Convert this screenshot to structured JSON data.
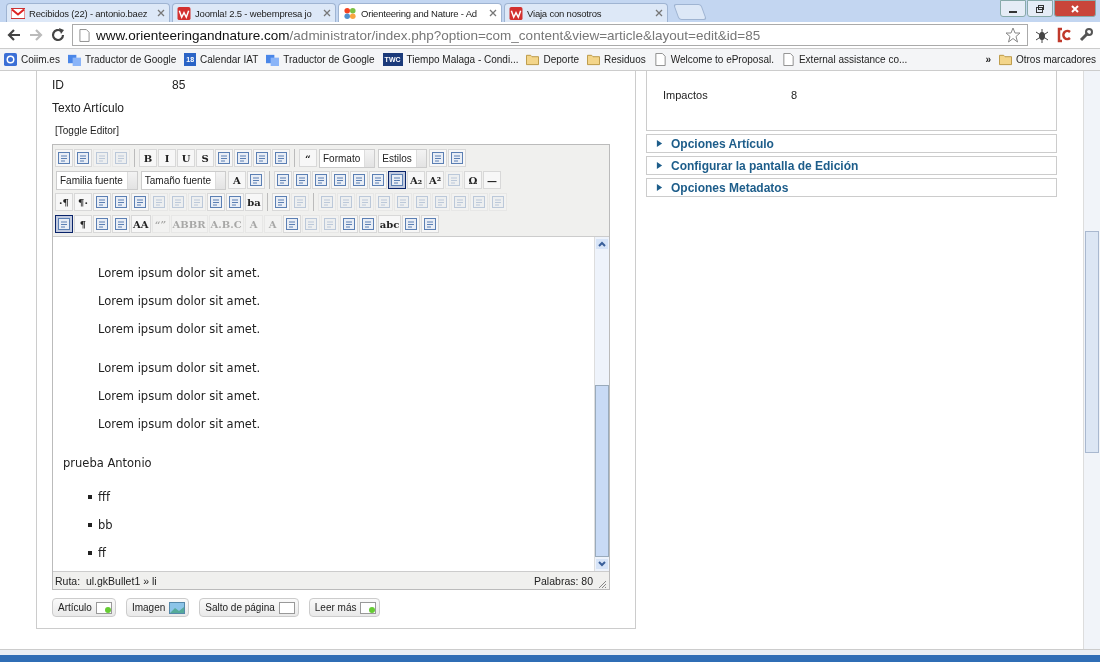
{
  "tabs": [
    {
      "title": "Recibidos (22) - antonio.baez",
      "kind": "mail",
      "selected": false
    },
    {
      "title": "Joomla! 2.5 - webempresa jo",
      "kind": "w",
      "selected": false
    },
    {
      "title": "Orienteering and Nature - Ad",
      "kind": "joomla",
      "selected": true
    },
    {
      "title": "Viaja con nosotros",
      "kind": "w",
      "selected": false
    }
  ],
  "address": {
    "host": "www.orienteeringandnature.com",
    "path": "/administrator/index.php?option=com_content&view=article&layout=edit&id=85"
  },
  "bookmarks": [
    {
      "label": "Coiim.es",
      "kind": "google"
    },
    {
      "label": "Traductor de Google",
      "kind": "translate"
    },
    {
      "label": "Calendar IAT",
      "kind": "calendar",
      "badge": "18"
    },
    {
      "label": "Traductor de Google",
      "kind": "translate"
    },
    {
      "label": "Tiempo Malaga - Condi...",
      "kind": "twc",
      "badge": "TWC"
    },
    {
      "label": "Deporte",
      "kind": "folder"
    },
    {
      "label": "Residuos",
      "kind": "folder"
    },
    {
      "label": "Welcome to eProposal.",
      "kind": "page"
    },
    {
      "label": "External assistance co...",
      "kind": "page"
    }
  ],
  "bookmarks_more": "»",
  "other_bookmarks": "Otros marcadores",
  "article": {
    "id_label": "ID",
    "id_value": "85",
    "text_label": "Texto Artículo",
    "toggle": "[Toggle Editor]"
  },
  "toolbar": [
    [
      {
        "kind": "icon",
        "disabled": false,
        "selected": false
      },
      {
        "kind": "icon",
        "disabled": false,
        "selected": false
      },
      {
        "kind": "icon",
        "disabled": true,
        "selected": false
      },
      {
        "kind": "icon",
        "disabled": true,
        "selected": false
      },
      {
        "kind": "sep"
      },
      {
        "kind": "text",
        "label": "B",
        "disabled": false,
        "selected": false
      },
      {
        "kind": "text",
        "label": "I",
        "disabled": false,
        "selected": false
      },
      {
        "kind": "text",
        "label": "U",
        "disabled": false,
        "selected": false
      },
      {
        "kind": "text",
        "label": "S",
        "disabled": false,
        "selected": false
      },
      {
        "kind": "icon",
        "disabled": false,
        "selected": false
      },
      {
        "kind": "icon",
        "disabled": false,
        "selected": false
      },
      {
        "kind": "icon",
        "disabled": false,
        "selected": false
      },
      {
        "kind": "icon",
        "disabled": false,
        "selected": false
      },
      {
        "kind": "sep"
      },
      {
        "kind": "text",
        "label": "“",
        "disabled": false,
        "selected": false
      },
      {
        "kind": "select",
        "label": "Formato"
      },
      {
        "kind": "select",
        "label": "Estilos"
      },
      {
        "kind": "icon",
        "disabled": false,
        "selected": false
      },
      {
        "kind": "icon",
        "disabled": false,
        "selected": false
      }
    ],
    [
      {
        "kind": "select",
        "label": "Familia fuente"
      },
      {
        "kind": "select",
        "label": "Tamaño fuente"
      },
      {
        "kind": "text",
        "label": "A",
        "disabled": false,
        "selected": false
      },
      {
        "kind": "icon",
        "disabled": false,
        "selected": false
      },
      {
        "kind": "sep"
      },
      {
        "kind": "icon",
        "disabled": false,
        "selected": false
      },
      {
        "kind": "icon",
        "disabled": false,
        "selected": false
      },
      {
        "kind": "icon",
        "disabled": false,
        "selected": false
      },
      {
        "kind": "icon",
        "disabled": false,
        "selected": false
      },
      {
        "kind": "icon",
        "disabled": false,
        "selected": false
      },
      {
        "kind": "icon",
        "disabled": false,
        "selected": false
      },
      {
        "kind": "icon",
        "disabled": false,
        "selected": true
      },
      {
        "kind": "text",
        "label": "A₂",
        "disabled": false,
        "selected": false
      },
      {
        "kind": "text",
        "label": "A²",
        "disabled": false,
        "selected": false
      },
      {
        "kind": "icon",
        "disabled": true,
        "selected": false
      },
      {
        "kind": "text",
        "label": "Ω",
        "disabled": false,
        "selected": false
      },
      {
        "kind": "text",
        "label": "—",
        "disabled": false,
        "selected": false
      }
    ],
    [
      {
        "kind": "text",
        "label": "·¶",
        "disabled": false,
        "selected": false
      },
      {
        "kind": "text",
        "label": "¶·",
        "disabled": false,
        "selected": false
      },
      {
        "kind": "icon",
        "disabled": false,
        "selected": false
      },
      {
        "kind": "icon",
        "disabled": false,
        "selected": false
      },
      {
        "kind": "icon",
        "disabled": false,
        "selected": false
      },
      {
        "kind": "icon",
        "disabled": true,
        "selected": false
      },
      {
        "kind": "icon",
        "disabled": true,
        "selected": false
      },
      {
        "kind": "icon",
        "disabled": true,
        "selected": false
      },
      {
        "kind": "icon",
        "disabled": false,
        "selected": false
      },
      {
        "kind": "icon",
        "disabled": false,
        "selected": false
      },
      {
        "kind": "text",
        "label": "ba",
        "disabled": false,
        "selected": false
      },
      {
        "kind": "sep"
      },
      {
        "kind": "icon",
        "disabled": false,
        "selected": false
      },
      {
        "kind": "icon",
        "disabled": true,
        "selected": false
      },
      {
        "kind": "sep"
      },
      {
        "kind": "icon",
        "disabled": true,
        "selected": false
      },
      {
        "kind": "icon",
        "disabled": true,
        "selected": false
      },
      {
        "kind": "icon",
        "disabled": true,
        "selected": false
      },
      {
        "kind": "icon",
        "disabled": true,
        "selected": false
      },
      {
        "kind": "icon",
        "disabled": true,
        "selected": false
      },
      {
        "kind": "icon",
        "disabled": true,
        "selected": false
      },
      {
        "kind": "icon",
        "disabled": true,
        "selected": false
      },
      {
        "kind": "icon",
        "disabled": true,
        "selected": false
      },
      {
        "kind": "icon",
        "disabled": true,
        "selected": false
      },
      {
        "kind": "icon",
        "disabled": true,
        "selected": false
      }
    ],
    [
      {
        "kind": "icon",
        "disabled": false,
        "selected": true
      },
      {
        "kind": "text",
        "label": "¶",
        "disabled": false,
        "selected": false
      },
      {
        "kind": "icon",
        "disabled": false,
        "selected": false
      },
      {
        "kind": "icon",
        "disabled": false,
        "selected": false
      },
      {
        "kind": "text",
        "label": "AA",
        "disabled": false,
        "selected": false
      },
      {
        "kind": "text",
        "label": "“”",
        "disabled": true,
        "selected": false
      },
      {
        "kind": "text",
        "label": "ABBR",
        "disabled": true,
        "selected": false
      },
      {
        "kind": "text",
        "label": "A.B.C",
        "disabled": true,
        "selected": false
      },
      {
        "kind": "text",
        "label": "A",
        "disabled": true,
        "selected": false
      },
      {
        "kind": "text",
        "label": "A",
        "disabled": true,
        "selected": false
      },
      {
        "kind": "icon",
        "disabled": false,
        "selected": false
      },
      {
        "kind": "icon",
        "disabled": true,
        "selected": false
      },
      {
        "kind": "icon",
        "disabled": true,
        "selected": false
      },
      {
        "kind": "icon",
        "disabled": false,
        "selected": false
      },
      {
        "kind": "icon",
        "disabled": false,
        "selected": false
      },
      {
        "kind": "text",
        "label": "abc",
        "disabled": false,
        "selected": false
      },
      {
        "kind": "icon",
        "disabled": false,
        "selected": false
      },
      {
        "kind": "icon",
        "disabled": false,
        "selected": false
      }
    ]
  ],
  "content": [
    {
      "kind": "indented",
      "lines": [
        "Lorem ipsum dolor sit amet.",
        "Lorem ipsum dolor sit amet.",
        "Lorem ipsum dolor sit amet."
      ]
    },
    {
      "kind": "indented",
      "lines": [
        "Lorem ipsum dolor sit amet.",
        "Lorem ipsum dolor sit amet.",
        "Lorem ipsum dolor sit amet."
      ]
    },
    {
      "kind": "para",
      "lines": [
        "prueba Antonio"
      ]
    },
    {
      "kind": "bullets",
      "lines": [
        "fff",
        "bb",
        "ff"
      ]
    }
  ],
  "status": {
    "path_label": "Ruta:",
    "path": "ul.gkBullet1 » li",
    "words": "Palabras: 80"
  },
  "buttons": [
    {
      "label": "Artículo",
      "kind": "doc"
    },
    {
      "label": "Imagen",
      "kind": "image"
    },
    {
      "label": "Salto de página",
      "kind": "blank"
    },
    {
      "label": "Leer más",
      "kind": "doc"
    }
  ],
  "details": [
    {
      "label": "Impactos",
      "value": "8"
    }
  ],
  "panels": [
    {
      "title": "Opciones Artículo",
      "expanded": false
    },
    {
      "title": "Configurar la pantalla de Edición",
      "expanded": false
    },
    {
      "title": "Opciones Metadatos",
      "expanded": false
    }
  ]
}
